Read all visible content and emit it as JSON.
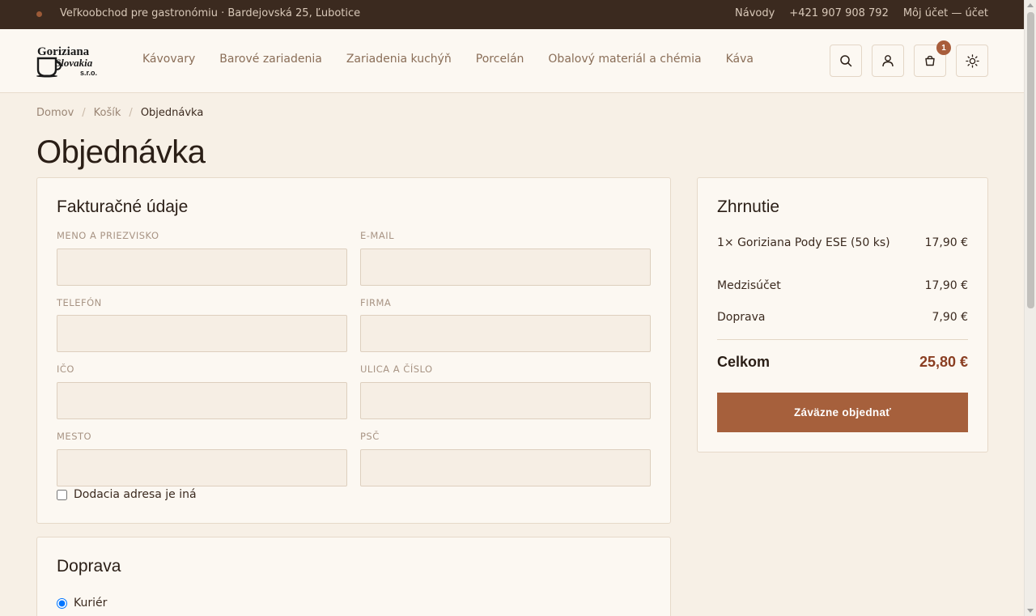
{
  "topbar": {
    "address": "Veľkoobchod pre gastronómiu · Bardejovská 25, Ľubotice",
    "links": [
      "Návody",
      "+421 907 908 792",
      "Môj účet — účet"
    ]
  },
  "header": {
    "logo": {
      "line1": "Goriziana",
      "line2": "Slovakia",
      "line3": "s.r.o."
    },
    "nav": [
      "Kávovary",
      "Barové zariadenia",
      "Zariadenia kuchýň",
      "Porcelán",
      "Obalový materiál a chémia",
      "Káva"
    ],
    "cart_count": "1",
    "icons": [
      "search-icon",
      "user-icon",
      "cart-icon",
      "theme-toggle-icon"
    ]
  },
  "breadcrumb": {
    "home": "Domov",
    "cart": "Košík",
    "current": "Objednávka",
    "separator": "/"
  },
  "page_title": "Objednávka",
  "billing": {
    "title": "Fakturačné údaje",
    "fields": {
      "name": {
        "label": "Meno a priezvisko",
        "value": ""
      },
      "email": {
        "label": "E-mail",
        "value": ""
      },
      "phone": {
        "label": "Telefón",
        "value": ""
      },
      "company": {
        "label": "Firma",
        "value": ""
      },
      "ico": {
        "label": "IČO",
        "value": ""
      },
      "street": {
        "label": "Ulica a číslo",
        "value": ""
      },
      "city": {
        "label": "Mesto",
        "value": ""
      },
      "zip": {
        "label": "PSČ",
        "value": ""
      }
    },
    "different_delivery_label": "Dodacia adresa je iná",
    "different_delivery_checked": false
  },
  "shipping": {
    "title": "Doprava",
    "options": [
      {
        "label": "Kuriér",
        "selected": true
      }
    ]
  },
  "summary": {
    "title": "Zhrnutie",
    "item": {
      "label": "1× Goriziana Pody ESE (50 ks)",
      "price": "17,90 €"
    },
    "subtotal": {
      "label": "Medzisúčet",
      "value": "17,90 €"
    },
    "delivery": {
      "label": "Doprava",
      "value": "7,90 €"
    },
    "total": {
      "label": "Celkom",
      "value": "25,80 €"
    },
    "submit_label": "Záväzne objednať"
  },
  "colors": {
    "accent": "#a6603c",
    "total": "#8a3e22",
    "topbar": "#3b2a1f",
    "page_bg": "#f7f0e6"
  }
}
